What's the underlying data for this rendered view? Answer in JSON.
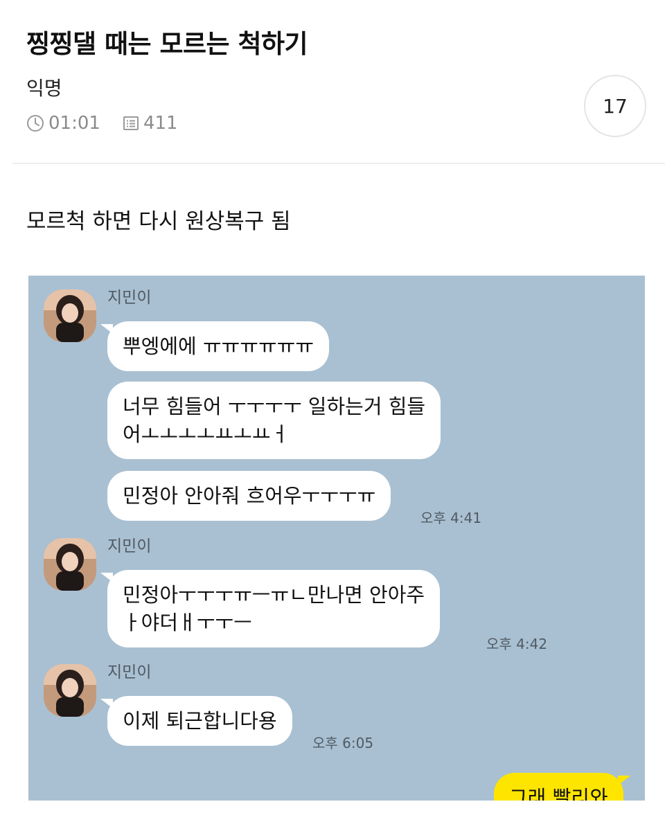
{
  "post": {
    "title": "찡찡댈 때는 모르는 척하기",
    "author": "익명",
    "time": "01:01",
    "views": "411",
    "comment_count": "17",
    "body": "모르척 하면 다시 원상복구 됨"
  },
  "chat": {
    "background_color": "#a9c0d2",
    "groups": [
      {
        "sender": "지민이",
        "messages": [
          "뿌엥에에 ㅠㅠㅠㅠㅠㅠ",
          "너무 힘들어 ㅜㅜㅜㅜ 일하는거 힘들\n어ㅗㅗㅗㅗㅛㅗㅛㅓ",
          "민정아 안아줘 흐어우ㅜㅜㅜㅠ"
        ],
        "time": "오후 4:41"
      },
      {
        "sender": "지민이",
        "messages": [
          "민정아ㅜㅜㅜㅠㅡㅠㄴ만나면 안아주\nㅏ야더ㅐㅜㅜㅡ"
        ],
        "time": "오후 4:42"
      },
      {
        "sender": "지민이",
        "messages": [
          "이제 퇴근합니다용"
        ],
        "time": "오후 6:05"
      }
    ],
    "my_message": "그래 빨리와"
  },
  "colors": {
    "my_bubble": "#fee500",
    "their_bubble": "#ffffff"
  },
  "icons": {
    "time": "clock-icon",
    "views": "list-icon",
    "avatar": "profile-photo"
  }
}
